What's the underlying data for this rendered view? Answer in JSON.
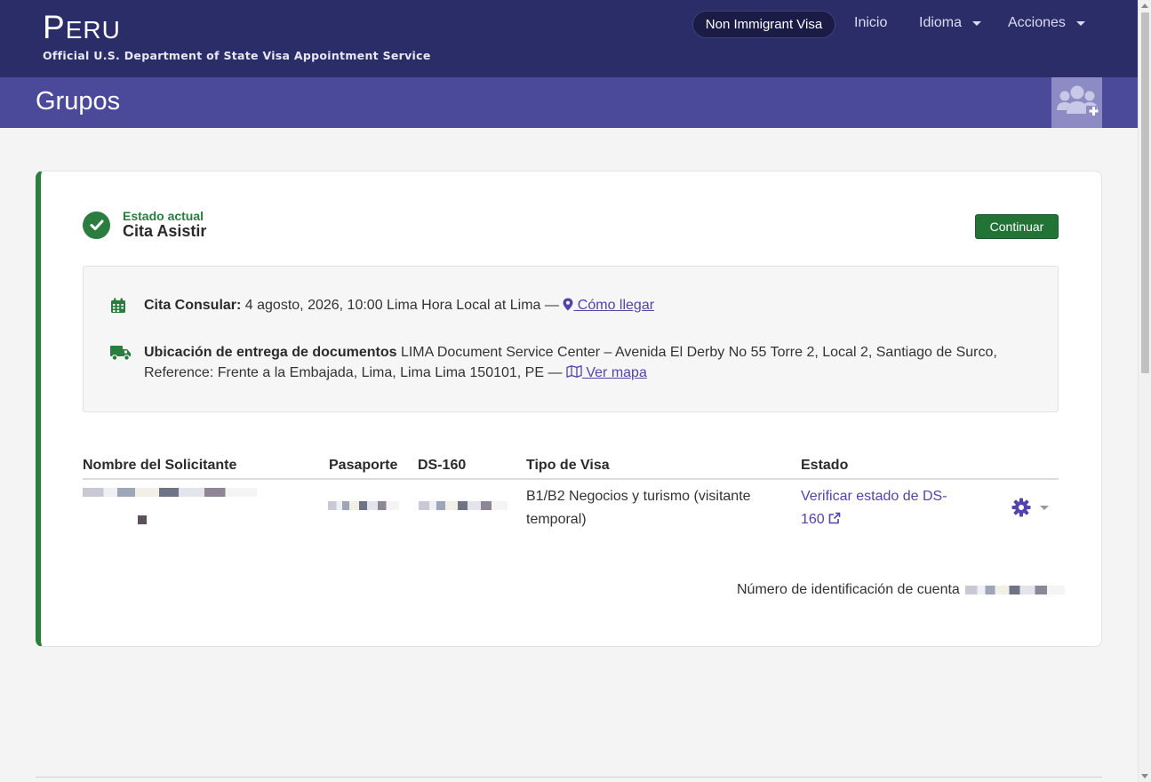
{
  "header": {
    "brand_first": "P",
    "brand_rest": "ERU",
    "brand_subtitle": "Official U.S. Department of State Visa Appointment Service",
    "nav": {
      "visa_type": "Non Immigrant Visa",
      "home": "Inicio",
      "language": "Idioma",
      "actions": "Acciones"
    }
  },
  "subheader": {
    "title": "Grupos",
    "add_group_icon": "users-plus-icon"
  },
  "status": {
    "label": "Estado actual",
    "value": "Cita Asistir",
    "continue_label": "Continuar"
  },
  "appointment": {
    "consular_label": "Cita Consular:",
    "consular_text": " 4 agosto, 2026, 10:00 Lima Hora Local at Lima — ",
    "directions_link": " Cómo llegar",
    "delivery_label": "Ubicación de entrega de documentos",
    "delivery_text": " LIMA Document Service Center – Avenida El Derby No 55 Torre 2, Local 2, Santiago de Surco, Reference: Frente a la Embajada, Lima, Lima Lima 150101, PE — ",
    "map_link": " Ver mapa"
  },
  "table": {
    "columns": [
      "Nombre del Solicitante",
      "Pasaporte",
      "DS-160",
      "Tipo de Visa",
      "Estado"
    ],
    "rows": [
      {
        "visa_type": "B1/B2 Negocios y turismo (visitante temporal)",
        "status_link": "Verificar estado de DS-160"
      }
    ]
  },
  "account": {
    "label": "Número de identificación de cuenta"
  },
  "colors": {
    "nav_bg": "#2b2d69",
    "subheader_bg": "#4b4a9a",
    "accent_green": "#2b7d3f",
    "link": "#5244a8"
  }
}
